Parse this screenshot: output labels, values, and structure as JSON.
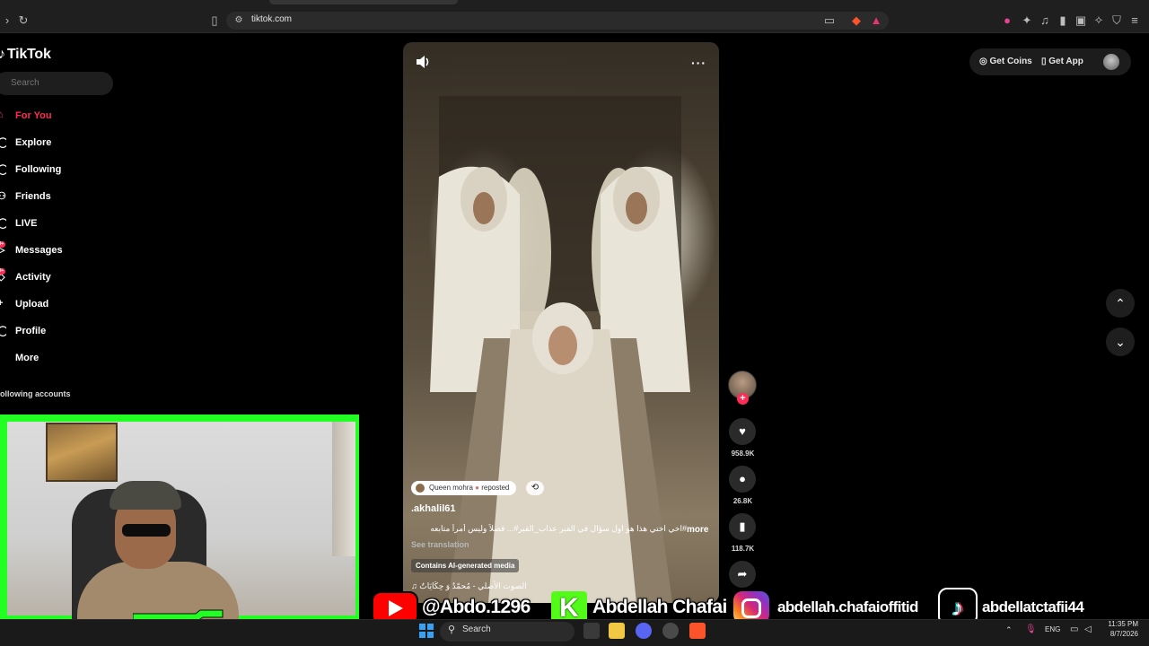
{
  "browser": {
    "url": "tiktok.com"
  },
  "sidebar": {
    "logo": "TikTok",
    "search_placeholder": "Search",
    "nav": [
      {
        "label": "For You",
        "icon": "home-icon",
        "active": true
      },
      {
        "label": "Explore",
        "icon": "compass-icon"
      },
      {
        "label": "Following",
        "icon": "following-icon"
      },
      {
        "label": "Friends",
        "icon": "friends-icon"
      },
      {
        "label": "LIVE",
        "icon": "live-icon"
      },
      {
        "label": "Messages",
        "icon": "messages-icon",
        "badge": "9+"
      },
      {
        "label": "Activity",
        "icon": "activity-icon",
        "badge": "9+"
      },
      {
        "label": "Upload",
        "icon": "upload-icon"
      },
      {
        "label": "Profile",
        "icon": "profile-icon"
      },
      {
        "label": "More",
        "icon": "more-icon"
      }
    ],
    "following_accounts": "ollowing accounts"
  },
  "video": {
    "repost_user": "Queen mohra",
    "repost_label": "reposted",
    "username": ".akhalil61",
    "caption": "#اخي اختي هذا هو اول سؤال في القبر عذاب_القبر#... فصلاً وليس أمراً متابعه",
    "more": "more",
    "see_translation": "See translation",
    "ai_label": "Contains AI-generated media",
    "music": "الصوت الأصلي - مُحمّدٌ وَ حِكَايَاتٌ"
  },
  "actions": {
    "likes": "958.9K",
    "comments": "26.8K",
    "saves": "118.7K"
  },
  "header": {
    "get_coins": "Get Coins",
    "get_app": "Get App"
  },
  "banner": {
    "youtube": "@Abdo.1296",
    "kick": "Abdellah Chafai",
    "instagram": "abdellah.chafaioffitid",
    "tiktok": "abdellatctafii44"
  },
  "taskbar": {
    "search": "Search",
    "lang": "ENG",
    "time": "11:35 PM",
    "date": "8/7/2026"
  },
  "colors": {
    "tiktok_red": "#fe2c55",
    "webcam_border": "#22ff22"
  }
}
